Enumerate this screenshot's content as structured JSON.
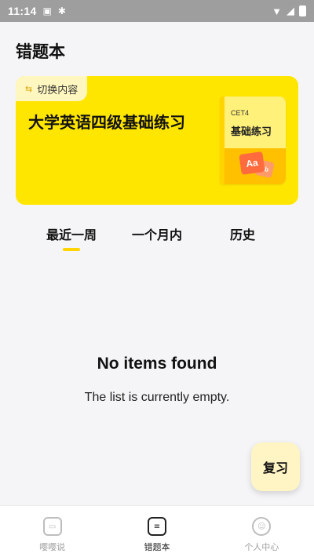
{
  "status_bar": {
    "time": "11:14",
    "icons": [
      "notification-a-icon",
      "bug-icon",
      "wifi-icon",
      "signal-icon",
      "battery-icon"
    ]
  },
  "header": {
    "title": "错题本"
  },
  "banner": {
    "switch_label": "切换内容",
    "title": "大学英语四级基础练习",
    "book": {
      "tag": "CET4",
      "title": "基础练习",
      "card_main": "Aa",
      "card_small": "Bb"
    },
    "colors": {
      "background": "#ffe600",
      "chip": "#fff7bf"
    }
  },
  "tabs": [
    {
      "label": "最近一周",
      "active": true
    },
    {
      "label": "一个月内",
      "active": false
    },
    {
      "label": "历史",
      "active": false
    }
  ],
  "empty_state": {
    "title": "No items found",
    "subtitle": "The list is currently empty."
  },
  "fab": {
    "label": "复习"
  },
  "bottom_nav": [
    {
      "label": "嘤嘤说",
      "icon": "chat-icon",
      "active": false
    },
    {
      "label": "错题本",
      "icon": "notebook-icon",
      "active": true
    },
    {
      "label": "个人中心",
      "icon": "profile-icon",
      "active": false
    }
  ],
  "accent_color": "#ffd400"
}
